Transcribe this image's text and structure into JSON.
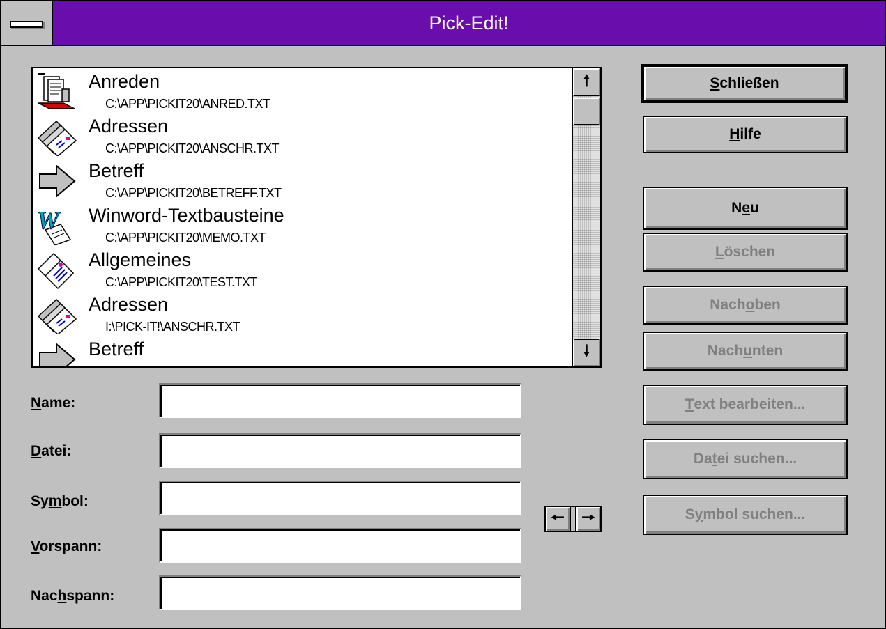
{
  "window": {
    "title": "Pick-Edit!"
  },
  "list": {
    "items": [
      {
        "name": "Anreden",
        "path": "C:\\APP\\PICKIT20\\ANRED.TXT",
        "icon": "letter-tray-icon"
      },
      {
        "name": "Adressen",
        "path": "C:\\APP\\PICKIT20\\ANSCHR.TXT",
        "icon": "envelopes-icon"
      },
      {
        "name": "Betreff",
        "path": "C:\\APP\\PICKIT20\\BETREFF.TXT",
        "icon": "arrow-right-icon"
      },
      {
        "name": "Winword-Textbausteine",
        "path": "C:\\APP\\PICKIT20\\MEMO.TXT",
        "icon": "winword-icon"
      },
      {
        "name": "Allgemeines",
        "path": "C:\\APP\\PICKIT20\\TEST.TXT",
        "icon": "documents-icon"
      },
      {
        "name": "Adressen",
        "path": "I:\\PICK-IT!\\ANSCHR.TXT",
        "icon": "envelopes-icon"
      },
      {
        "name": "Betreff",
        "path": "",
        "icon": "arrow-right-icon"
      }
    ]
  },
  "buttons": {
    "close": {
      "pre": "",
      "key": "S",
      "post": "chließen"
    },
    "help": {
      "pre": "",
      "key": "H",
      "post": "ilfe"
    },
    "new": {
      "pre": "N",
      "key": "e",
      "post": "u"
    },
    "delete": {
      "pre": "",
      "key": "L",
      "post": "öschen"
    },
    "move_up": {
      "pre": "Nach ",
      "key": "o",
      "post": "ben"
    },
    "move_down": {
      "pre": "Nach ",
      "key": "u",
      "post": "nten"
    },
    "edit_text": {
      "pre": "",
      "key": "T",
      "post": "ext bearbeiten..."
    },
    "find_file": {
      "pre": "Da",
      "key": "t",
      "post": "ei suchen..."
    },
    "find_symbol": {
      "pre": "S",
      "key": "y",
      "post": "mbol suchen..."
    }
  },
  "form": {
    "name": {
      "pre": "",
      "key": "N",
      "post": "ame:",
      "value": ""
    },
    "file": {
      "pre": "",
      "key": "D",
      "post": "atei:",
      "value": ""
    },
    "symbol": {
      "pre": "Sy",
      "key": "m",
      "post": "bol:",
      "value": ""
    },
    "prefix": {
      "pre": "",
      "key": "V",
      "post": "orspann:",
      "value": ""
    },
    "suffix": {
      "pre": "Nac",
      "key": "h",
      "post": "spann:",
      "value": ""
    }
  },
  "scroll": {
    "up_glyph": "🠕",
    "down_glyph": "🠗"
  },
  "nav": {
    "left_glyph": "🠔",
    "right_glyph": "🠖"
  },
  "colors": {
    "titlebar": "#6a0dad",
    "face": "#c0c0c0",
    "disabled_text": "#808080"
  }
}
